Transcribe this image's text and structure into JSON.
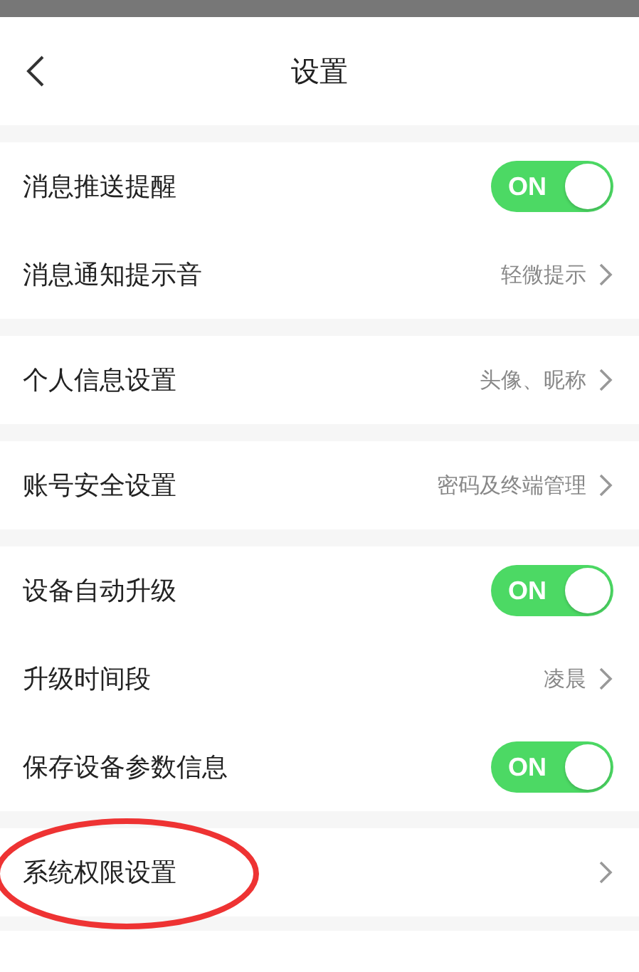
{
  "header": {
    "title": "设置"
  },
  "groups": [
    {
      "items": [
        {
          "kind": "toggle",
          "label": "消息推送提醒",
          "on": true,
          "toggle_text": "ON"
        },
        {
          "kind": "link",
          "label": "消息通知提示音",
          "value": "轻微提示"
        }
      ]
    },
    {
      "items": [
        {
          "kind": "link",
          "label": "个人信息设置",
          "value": "头像、昵称"
        }
      ]
    },
    {
      "items": [
        {
          "kind": "link",
          "label": "账号安全设置",
          "value": "密码及终端管理"
        }
      ]
    },
    {
      "items": [
        {
          "kind": "toggle",
          "label": "设备自动升级",
          "on": true,
          "toggle_text": "ON"
        },
        {
          "kind": "link",
          "label": "升级时间段",
          "value": "凌晨"
        },
        {
          "kind": "toggle",
          "label": "保存设备参数信息",
          "on": true,
          "toggle_text": "ON"
        }
      ]
    },
    {
      "items": [
        {
          "kind": "link",
          "label": "系统权限设置",
          "circled": true
        }
      ]
    }
  ]
}
